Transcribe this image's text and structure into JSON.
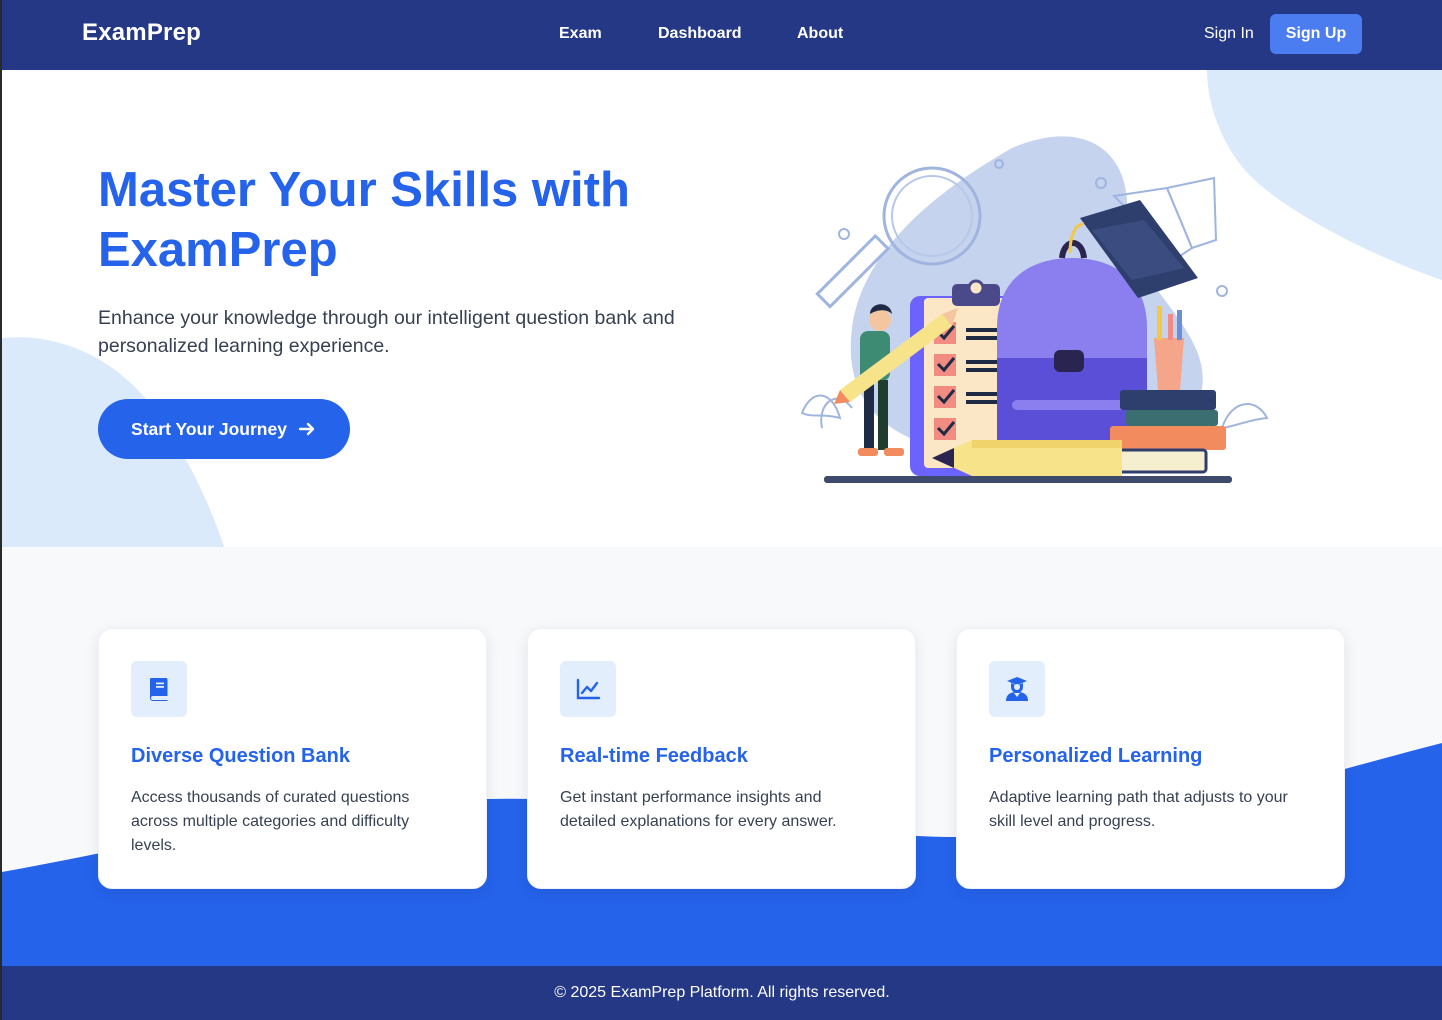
{
  "nav": {
    "brand": "ExamPrep",
    "links": [
      {
        "label": "Exam"
      },
      {
        "label": "Dashboard"
      },
      {
        "label": "About"
      }
    ],
    "sign_in": "Sign In",
    "sign_up": "Sign Up"
  },
  "hero": {
    "title": "Master Your Skills with ExamPrep",
    "subtitle": "Enhance your knowledge through our intelligent question bank and personalized learning experience.",
    "cta": "Start Your Journey",
    "cta_icon": "arrow-right-icon",
    "illustration": "student-study-illustration"
  },
  "features": [
    {
      "icon": "book-icon",
      "title": "Diverse Question Bank",
      "description": "Access thousands of curated questions across multiple categories and difficulty levels."
    },
    {
      "icon": "chart-line-icon",
      "title": "Real-time Feedback",
      "description": "Get instant performance insights and detailed explanations for every answer."
    },
    {
      "icon": "graduate-icon",
      "title": "Personalized Learning",
      "description": "Adaptive learning path that adjusts to your skill level and progress."
    }
  ],
  "footer": {
    "text": "© 2025 ExamPrep Platform. All rights reserved."
  },
  "colors": {
    "primary": "#2563eb",
    "navy": "#253885",
    "signup_button": "#4b7cf0",
    "blob": "#dbeafb",
    "icon_bg": "#e3eefc"
  }
}
